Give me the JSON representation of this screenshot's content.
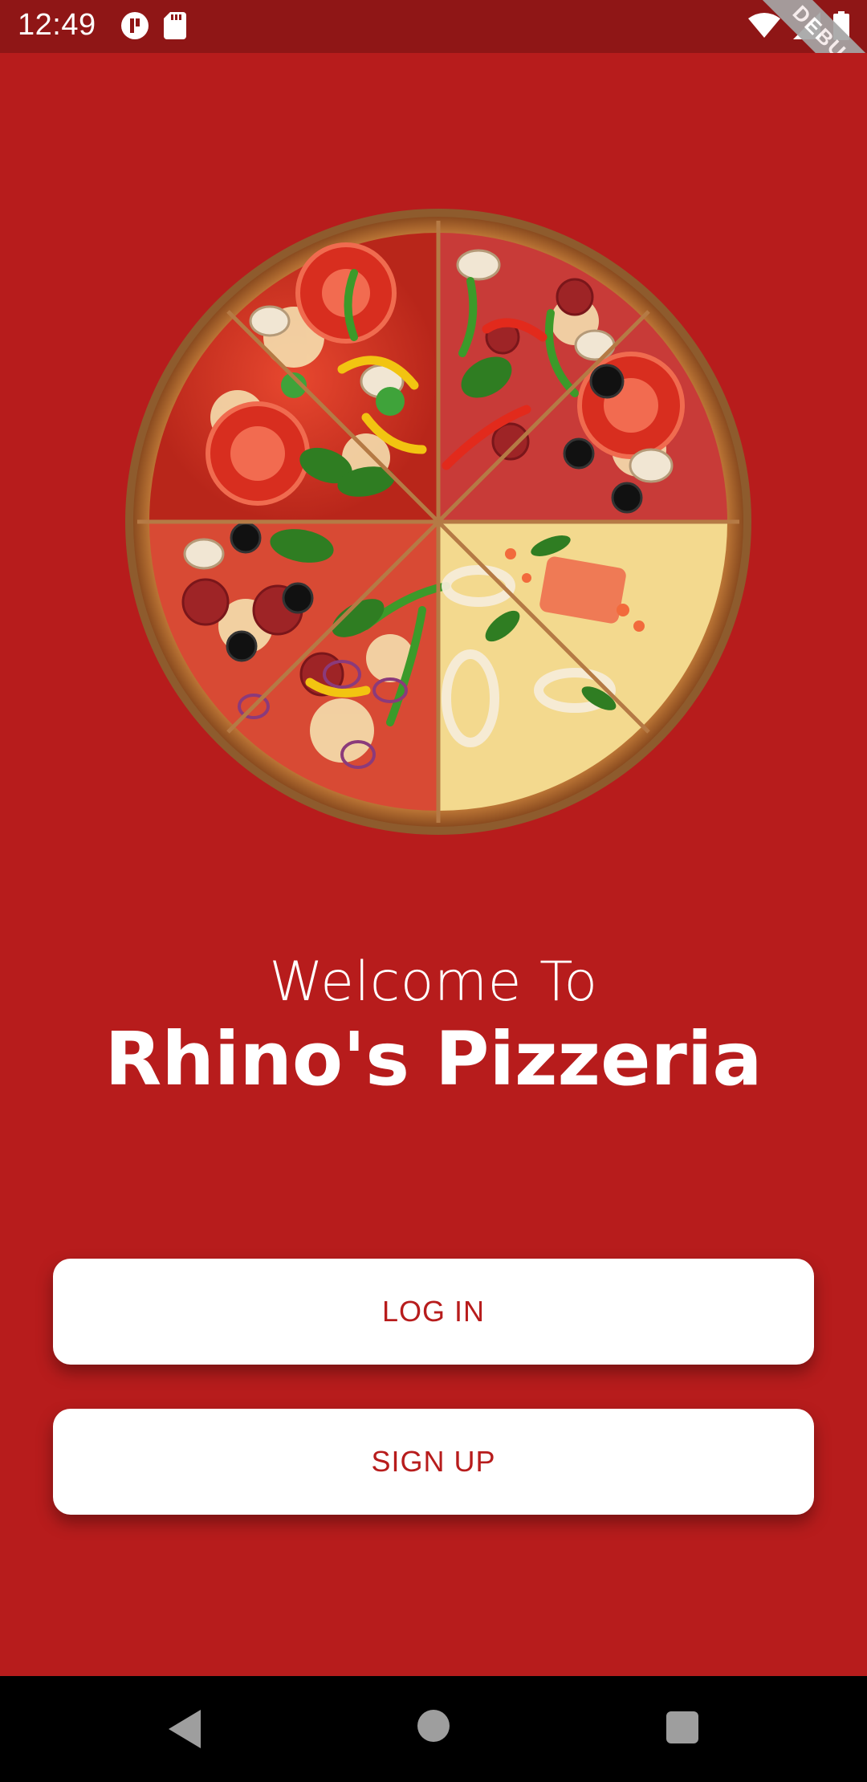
{
  "status_bar": {
    "time": "12:49",
    "left_icons": [
      "app-notification-icon",
      "sd-card-icon"
    ],
    "right_icons": [
      "wifi-icon",
      "cellular-signal-icon",
      "battery-icon"
    ]
  },
  "debug_banner": {
    "label": "DEBUG"
  },
  "hero": {
    "image": "pizza-image"
  },
  "welcome": {
    "line1": "Welcome To",
    "line2": "Rhino's Pizzeria"
  },
  "actions": {
    "login_label": "LOG IN",
    "signup_label": "SIGN UP"
  },
  "nav_bar": {
    "icons": [
      "back-icon",
      "home-icon",
      "recents-icon"
    ]
  },
  "colors": {
    "background": "#b71c1c",
    "status_bar": "#8f1616",
    "button_bg": "#ffffff",
    "button_text": "#b71c1c"
  }
}
